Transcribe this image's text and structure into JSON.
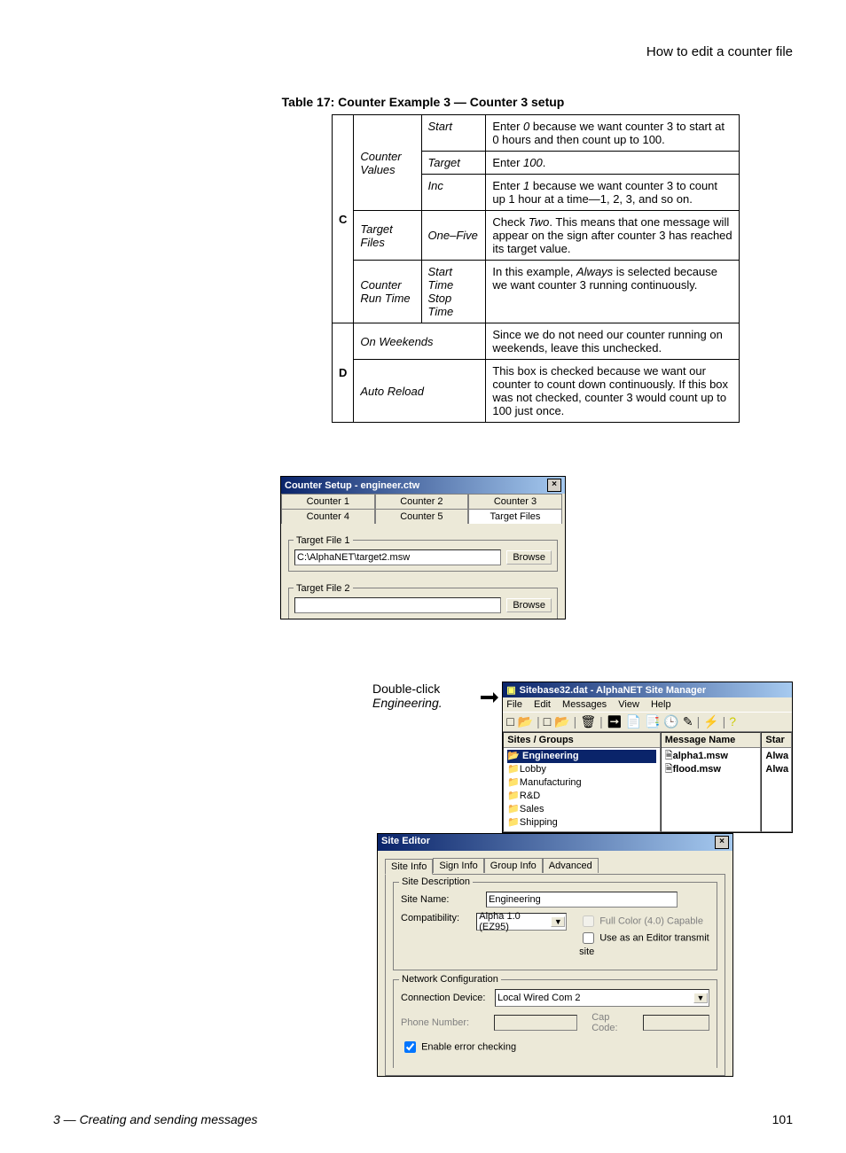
{
  "header": {
    "text": "How to edit a counter file"
  },
  "table": {
    "caption": "Table 17: Counter Example 3 — Counter 3 setup",
    "rows": [
      {
        "section": "C",
        "group": "Counter Values",
        "field": "Start",
        "desc_pre": "Enter ",
        "desc_em1": "0",
        "desc_post": " because we want counter 3 to start at 0 hours and then count up to 100."
      },
      {
        "field": "Target",
        "desc_pre": "Enter ",
        "desc_em1": "100",
        "desc_post": "."
      },
      {
        "field": "Inc",
        "desc_pre": "Enter ",
        "desc_em1": "1",
        "desc_post": " because we want counter 3 to count up 1 hour at a time—1, 2, 3, and so on."
      },
      {
        "group": "Target Files",
        "field": "One–Five",
        "desc_pre": "Check ",
        "desc_em1": "Two",
        "desc_post": ". This means that one message will appear on the sign after counter 3 has reached its target value."
      },
      {
        "group": "Counter Run Time",
        "field": "Start Time Stop Time",
        "desc_pre": "In this example, ",
        "desc_em1": "Always",
        "desc_post": " is selected because we want counter 3 running continuously."
      },
      {
        "section": "D",
        "group": "On Weekends",
        "desc_plain": "Since we do not need our counter running on weekends, leave this unchecked."
      },
      {
        "group": "Auto Reload",
        "desc_plain": "This box is checked because we want our counter to count down continuously. If this box was not checked, counter 3 would count up to 100 just once."
      }
    ]
  },
  "counter_setup": {
    "title": "Counter Setup - engineer.ctw",
    "tabs": [
      "Counter 1",
      "Counter 2",
      "Counter 3",
      "Counter 4",
      "Counter 5",
      "Target Files"
    ],
    "tf1_legend": "Target File 1",
    "tf1_value": "C:\\AlphaNET\\target2.msw",
    "tf2_legend": "Target File 2",
    "tf2_value": "",
    "browse": "Browse"
  },
  "annotation": {
    "line1": "Double-click",
    "line2": "Engineering."
  },
  "site_manager": {
    "title": "Sitebase32.dat - AlphaNET Site Manager",
    "menu": [
      "File",
      "Edit",
      "Messages",
      "View",
      "Help"
    ],
    "col1_header": "Sites / Groups",
    "col2_header": "Message Name",
    "col3_header": "Star",
    "groups": [
      "Engineering",
      "Lobby",
      "Manufacturing",
      "R&D",
      "Sales",
      "Shipping"
    ],
    "messages": [
      "alpha1.msw",
      "flood.msw"
    ],
    "starts": [
      "Alwa",
      "Alwa"
    ]
  },
  "site_editor": {
    "title": "Site Editor",
    "tabs": [
      "Site Info",
      "Sign Info",
      "Group Info",
      "Advanced"
    ],
    "group1_legend": "Site Description",
    "site_name_label": "Site Name:",
    "site_name_value": "Engineering",
    "compat_label": "Compatibility:",
    "compat_value": "Alpha 1.0 (EZ95)",
    "check_fullcolor": "Full Color (4.0) Capable",
    "check_editor": "Use as an Editor transmit site",
    "group2_legend": "Network Configuration",
    "conn_label": "Connection Device:",
    "conn_value": "Local Wired Com 2",
    "phone_label": "Phone Number:",
    "cap_label": "Cap Code:",
    "check_error": "Enable error checking"
  },
  "footer": {
    "chapter": "3 — Creating and sending messages",
    "page": "101"
  }
}
